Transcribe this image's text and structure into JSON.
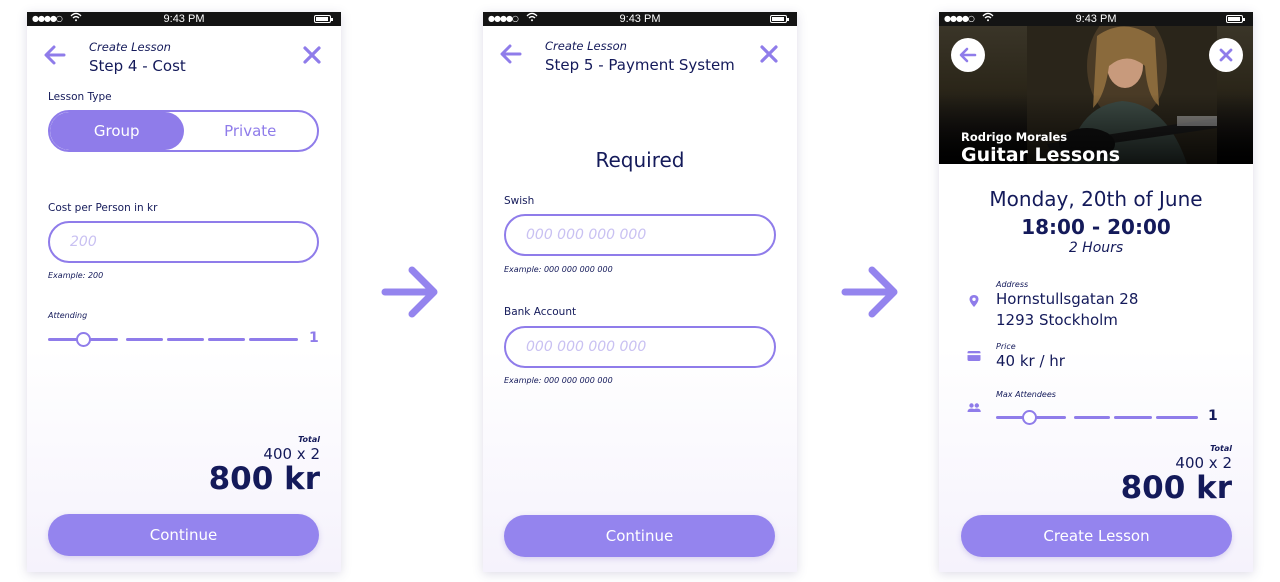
{
  "status": {
    "time": "9:43 PM"
  },
  "screen1": {
    "subtitle": "Create Lesson",
    "title": "Step 4 - Cost",
    "lesson_type_label": "Lesson Type",
    "lesson_types": [
      "Group",
      "Private"
    ],
    "selected_lesson_type": "Group",
    "cost_label": "Cost per Person in kr",
    "cost_placeholder": "200",
    "cost_example": "Example: 200",
    "attending_label": "Attending",
    "attending_value": "1",
    "total_label": "Total",
    "total_calc": "400 x 2",
    "total_value": "800 kr",
    "continue_label": "Continue"
  },
  "screen2": {
    "subtitle": "Create Lesson",
    "title": "Step 5 - Payment System",
    "required_heading": "Required",
    "swish_label": "Swish",
    "swish_placeholder": "000 000 000 000",
    "swish_example": "Example: 000 000 000 000",
    "bank_label": "Bank Account",
    "bank_placeholder": "000 000 000 000",
    "bank_example": "Example: 000 000 000 000",
    "continue_label": "Continue"
  },
  "screen3": {
    "teacher": "Rodrigo Morales",
    "lesson_title": "Guitar Lessons",
    "date": "Monday, 20th of June",
    "time_range": "18:00 - 20:00",
    "duration": "2 Hours",
    "address_label": "Address",
    "address_line1": "Hornstullsgatan 28",
    "address_line2": "1293 Stockholm",
    "price_label": "Price",
    "price_value": "40 kr / hr",
    "max_label": "Max Attendees",
    "max_value": "1",
    "total_label": "Total",
    "total_calc": "400 x 2",
    "total_value": "800 kr",
    "create_label": "Create Lesson"
  },
  "icons": {
    "back": "arrow-left-icon",
    "close": "close-icon",
    "flow": "arrow-right-icon",
    "location": "location-pin-icon",
    "card": "credit-card-icon",
    "people": "people-icon"
  },
  "colors": {
    "accent": "#8f7cea",
    "button": "#9484ee",
    "text": "#141a5a",
    "placeholder": "#c9c1f2"
  }
}
